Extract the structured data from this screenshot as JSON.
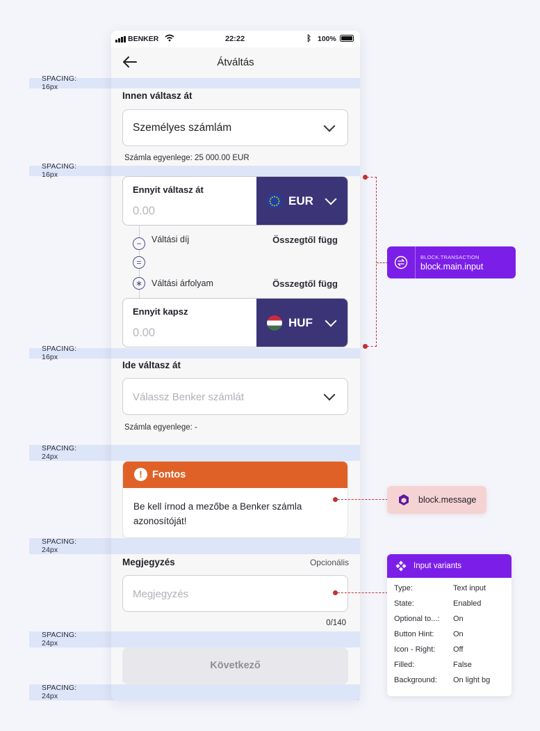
{
  "status_bar": {
    "carrier": "BENKER",
    "time": "22:22",
    "battery": "100%"
  },
  "nav": {
    "title": "Átváltás"
  },
  "spacing_labels": {
    "s16": "SPACING: 16px",
    "s24": "SPACING: 24px"
  },
  "from_section": {
    "label": "Innen váltasz át",
    "selected_account": "Személyes számlám",
    "balance_text": "Számla egyenlege: 25 000.00 EUR"
  },
  "send_amount": {
    "label": "Ennyit váltasz át",
    "placeholder": "0.00",
    "currency": "EUR"
  },
  "fees": {
    "fee_label": "Váltási díj",
    "fee_value": "Összegtől függ",
    "rate_label": "Váltási árfolyam",
    "rate_value": "Összegtől függ",
    "minus_symbol": "−",
    "equals_symbol": "=",
    "asterisk_symbol": "∗"
  },
  "receive_amount": {
    "label": "Ennyit kapsz",
    "placeholder": "0.00",
    "currency": "HUF"
  },
  "to_section": {
    "label": "Ide váltasz át",
    "placeholder": "Válassz Benker számlát",
    "balance_text": "Számla egyenlege: -"
  },
  "message": {
    "icon_glyph": "!",
    "title": "Fontos",
    "body": "Be kell írnod a mezőbe a Benker számla azonosítóját!",
    "accent": "#e06127"
  },
  "note": {
    "label": "Megjegyzés",
    "optional": "Opcionális",
    "placeholder": "Megjegyzés",
    "counter": "0/140"
  },
  "next_button": {
    "label": "Következő"
  },
  "annotation_transaction": {
    "small_label": "BLOCK.TRANSACTION",
    "name": "block.main.input",
    "color": "#7b1fe8"
  },
  "annotation_message": {
    "name": "block.message",
    "color": "#f6d3d3"
  },
  "variants": {
    "title": "Input variants",
    "rows": [
      {
        "key": "Type:",
        "value": "Text input"
      },
      {
        "key": "State:",
        "value": "Enabled"
      },
      {
        "key": "Optional to...:",
        "value": "On"
      },
      {
        "key": "Button Hint:",
        "value": "On"
      },
      {
        "key": "Icon - Right:",
        "value": "Off"
      },
      {
        "key": "Filled:",
        "value": "False"
      },
      {
        "key": "Background:",
        "value": "On light bg"
      }
    ]
  },
  "colors": {
    "primary_dark": "#3b3577",
    "annotation_red": "#c03232",
    "spacing_band": "#dde5f8"
  }
}
